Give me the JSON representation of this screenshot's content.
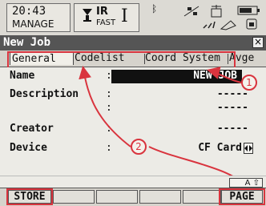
{
  "status": {
    "time": "20:43",
    "mode": "MANAGE",
    "edm_mode": "IR",
    "edm_speed": "FAST",
    "cursor_indicator": "I",
    "icons": [
      "prism-icon",
      "bluetooth-icon",
      "satellite-icon",
      "instrument-icon",
      "battery-icon",
      "memory-card-icon"
    ]
  },
  "window": {
    "title": "New Job",
    "close_label": "×"
  },
  "tabs": [
    {
      "label": "General",
      "active": true
    },
    {
      "label": "Codelist",
      "active": false
    },
    {
      "label": "Coord System",
      "active": false
    },
    {
      "label": "Avge",
      "active": false
    }
  ],
  "fields": [
    {
      "label": "Name",
      "value": "NEW JOB"
    },
    {
      "label": "Description",
      "value": "-----",
      "value2": "-----"
    },
    {
      "label": "Creator",
      "value": "-----"
    },
    {
      "label": "Device",
      "value": "CF Card"
    }
  ],
  "annotations": {
    "callout_1": "1",
    "callout_2": "2",
    "highlight_color": "#d9343e"
  },
  "indicator": "A ⇧",
  "fkeys": {
    "f1": "STORE",
    "f6": "PAGE"
  }
}
